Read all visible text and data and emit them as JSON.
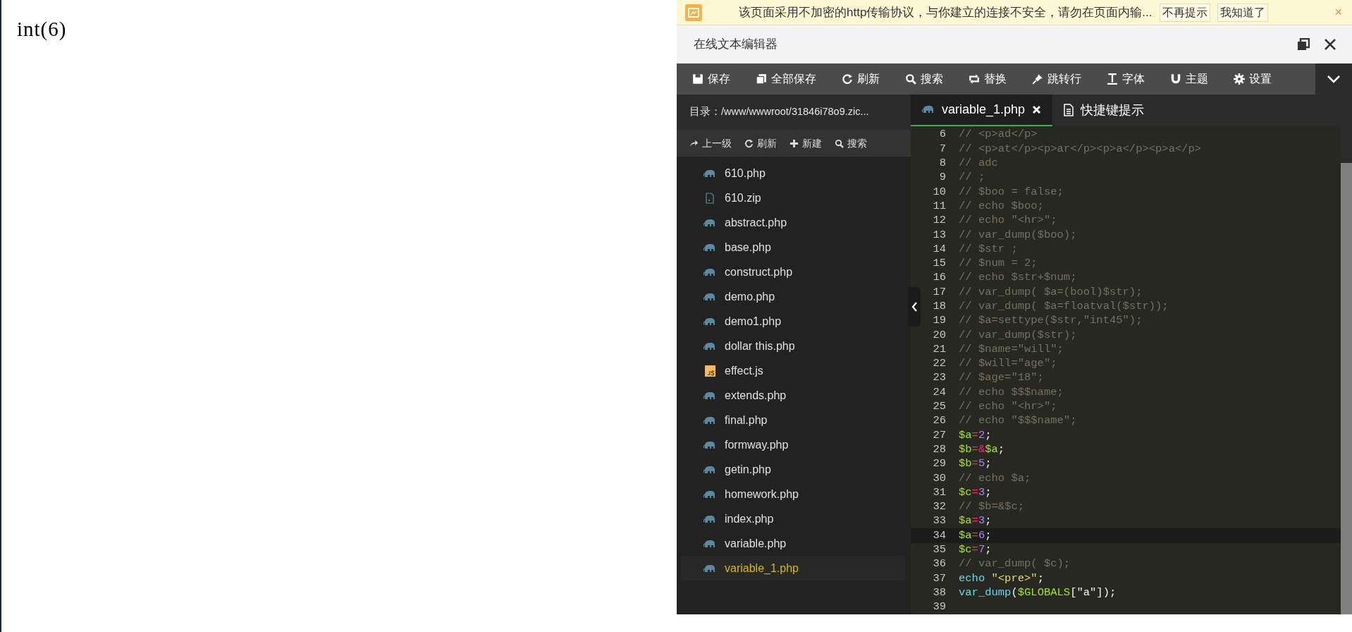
{
  "output": {
    "text": "int(6)"
  },
  "notice": {
    "text": "该页面采用不加密的http传输协议，与你建立的连接不安全，请勿在页面内输...",
    "buttons": [
      "不再提示",
      "我知道了"
    ],
    "close": "×"
  },
  "editor": {
    "title": "在线文本编辑器",
    "toolbar": [
      {
        "kind": "save",
        "label": "保存"
      },
      {
        "kind": "saveall",
        "label": "全部保存"
      },
      {
        "kind": "refresh",
        "label": "刷新"
      },
      {
        "kind": "search",
        "label": "搜索"
      },
      {
        "kind": "replace",
        "label": "替换"
      },
      {
        "kind": "goto",
        "label": "跳转行"
      },
      {
        "kind": "font",
        "label": "字体"
      },
      {
        "kind": "theme",
        "label": "主题"
      },
      {
        "kind": "settings",
        "label": "设置"
      }
    ],
    "directory": "目录：/www/wwwroot/31846i78o9.zic...",
    "tabs": [
      {
        "kind": "file",
        "label": "variable_1.php",
        "selected": true
      },
      {
        "kind": "doc",
        "label": "快捷键提示",
        "selected": false
      }
    ],
    "file_toolbar": [
      {
        "kind": "up",
        "label": "上一级"
      },
      {
        "kind": "refresh",
        "label": "刷新"
      },
      {
        "kind": "new",
        "label": "新建"
      },
      {
        "kind": "search",
        "label": "搜索"
      }
    ],
    "files": [
      {
        "kind": "php",
        "name": "610.php",
        "selected": false
      },
      {
        "kind": "zip",
        "name": "610.zip",
        "selected": false
      },
      {
        "kind": "php",
        "name": "abstract.php",
        "selected": false
      },
      {
        "kind": "php",
        "name": "base.php",
        "selected": false
      },
      {
        "kind": "php",
        "name": "construct.php",
        "selected": false
      },
      {
        "kind": "php",
        "name": "demo.php",
        "selected": false
      },
      {
        "kind": "php",
        "name": "demo1.php",
        "selected": false
      },
      {
        "kind": "php",
        "name": "dollar this.php",
        "selected": false
      },
      {
        "kind": "js",
        "name": "effect.js",
        "selected": false
      },
      {
        "kind": "php",
        "name": "extends.php",
        "selected": false
      },
      {
        "kind": "php",
        "name": "final.php",
        "selected": false
      },
      {
        "kind": "php",
        "name": "formway.php",
        "selected": false
      },
      {
        "kind": "php",
        "name": "getin.php",
        "selected": false
      },
      {
        "kind": "php",
        "name": "homework.php",
        "selected": false
      },
      {
        "kind": "php",
        "name": "index.php",
        "selected": false
      },
      {
        "kind": "php",
        "name": "variable.php",
        "selected": false
      },
      {
        "kind": "php",
        "name": "variable_1.php",
        "selected": true
      }
    ],
    "code": [
      {
        "number": "6",
        "active": false,
        "tokens": [
          {
            "kind": "comment",
            "text": "// <p>ad</p>"
          }
        ]
      },
      {
        "number": "7",
        "active": false,
        "tokens": [
          {
            "kind": "comment",
            "text": "// <p>at</p><p>ar</p><p>a</p><p>a</p>"
          }
        ]
      },
      {
        "number": "8",
        "active": false,
        "tokens": [
          {
            "kind": "comment",
            "text": "// adc"
          }
        ]
      },
      {
        "number": "9",
        "active": false,
        "tokens": [
          {
            "kind": "comment",
            "text": "// ;"
          }
        ]
      },
      {
        "number": "10",
        "active": false,
        "tokens": [
          {
            "kind": "comment",
            "text": "// $boo = false;"
          }
        ]
      },
      {
        "number": "11",
        "active": false,
        "tokens": [
          {
            "kind": "comment",
            "text": "// echo $boo;"
          }
        ]
      },
      {
        "number": "12",
        "active": false,
        "tokens": [
          {
            "kind": "comment",
            "text": "// echo \"<hr>\";"
          }
        ]
      },
      {
        "number": "13",
        "active": false,
        "tokens": [
          {
            "kind": "comment",
            "text": "// var_dump($boo);"
          }
        ]
      },
      {
        "number": "14",
        "active": false,
        "tokens": [
          {
            "kind": "comment",
            "text": "// $str ;"
          }
        ]
      },
      {
        "number": "15",
        "active": false,
        "tokens": [
          {
            "kind": "comment",
            "text": "// $num = 2;"
          }
        ]
      },
      {
        "number": "16",
        "active": false,
        "tokens": [
          {
            "kind": "comment",
            "text": "// echo $str+$num;"
          }
        ]
      },
      {
        "number": "17",
        "active": false,
        "tokens": [
          {
            "kind": "comment",
            "text": "// var_dump( $a=(bool)$str);"
          }
        ]
      },
      {
        "number": "18",
        "active": false,
        "tokens": [
          {
            "kind": "comment",
            "text": "// var_dump( $a=floatval($str));"
          }
        ]
      },
      {
        "number": "19",
        "active": false,
        "tokens": [
          {
            "kind": "comment",
            "text": "// $a=settype($str,\"int45\");"
          }
        ]
      },
      {
        "number": "20",
        "active": false,
        "tokens": [
          {
            "kind": "comment",
            "text": "// var_dump($str);"
          }
        ]
      },
      {
        "number": "21",
        "active": false,
        "tokens": [
          {
            "kind": "comment",
            "text": "// $name=\"will\";"
          }
        ]
      },
      {
        "number": "22",
        "active": false,
        "tokens": [
          {
            "kind": "comment",
            "text": "// $will=\"age\";"
          }
        ]
      },
      {
        "number": "23",
        "active": false,
        "tokens": [
          {
            "kind": "comment",
            "text": "// $age=\"18\";"
          }
        ]
      },
      {
        "number": "24",
        "active": false,
        "tokens": [
          {
            "kind": "comment",
            "text": "// echo $$$name;"
          }
        ]
      },
      {
        "number": "25",
        "active": false,
        "tokens": [
          {
            "kind": "comment",
            "text": "// echo \"<hr>\";"
          }
        ]
      },
      {
        "number": "26",
        "active": false,
        "tokens": [
          {
            "kind": "comment",
            "text": "// echo \"$$$name\";"
          }
        ]
      },
      {
        "number": "27",
        "active": false,
        "tokens": [
          {
            "kind": "var",
            "text": "$a"
          },
          {
            "kind": "op",
            "text": "="
          },
          {
            "kind": "num",
            "text": "2"
          },
          {
            "kind": "plain",
            "text": ";"
          }
        ]
      },
      {
        "number": "28",
        "active": false,
        "tokens": [
          {
            "kind": "var",
            "text": "$b"
          },
          {
            "kind": "op",
            "text": "=&"
          },
          {
            "kind": "var",
            "text": "$a"
          },
          {
            "kind": "plain",
            "text": ";"
          }
        ]
      },
      {
        "number": "29",
        "active": false,
        "tokens": [
          {
            "kind": "var",
            "text": "$b"
          },
          {
            "kind": "op",
            "text": "="
          },
          {
            "kind": "num",
            "text": "5"
          },
          {
            "kind": "plain",
            "text": ";"
          }
        ]
      },
      {
        "number": "30",
        "active": false,
        "tokens": [
          {
            "kind": "comment",
            "text": "// echo $a;"
          }
        ]
      },
      {
        "number": "31",
        "active": false,
        "tokens": [
          {
            "kind": "var",
            "text": "$c"
          },
          {
            "kind": "op",
            "text": "="
          },
          {
            "kind": "num",
            "text": "3"
          },
          {
            "kind": "plain",
            "text": ";"
          }
        ]
      },
      {
        "number": "32",
        "active": false,
        "tokens": [
          {
            "kind": "comment",
            "text": "// $b=&$c;"
          }
        ]
      },
      {
        "number": "33",
        "active": false,
        "tokens": [
          {
            "kind": "var",
            "text": "$a"
          },
          {
            "kind": "op",
            "text": "="
          },
          {
            "kind": "num",
            "text": "3"
          },
          {
            "kind": "plain",
            "text": ";"
          }
        ]
      },
      {
        "number": "34",
        "active": true,
        "tokens": [
          {
            "kind": "var",
            "text": "$a"
          },
          {
            "kind": "op",
            "text": "="
          },
          {
            "kind": "num",
            "text": "6"
          },
          {
            "kind": "plain",
            "text": ";"
          }
        ]
      },
      {
        "number": "35",
        "active": false,
        "tokens": [
          {
            "kind": "var",
            "text": "$c"
          },
          {
            "kind": "op",
            "text": "="
          },
          {
            "kind": "num",
            "text": "7"
          },
          {
            "kind": "plain",
            "text": ";"
          }
        ]
      },
      {
        "number": "36",
        "active": false,
        "tokens": [
          {
            "kind": "comment",
            "text": "// var_dump( $c);"
          }
        ]
      },
      {
        "number": "37",
        "active": false,
        "tokens": [
          {
            "kind": "func",
            "text": "echo "
          },
          {
            "kind": "str",
            "text": "\"<pre>\""
          },
          {
            "kind": "plain",
            "text": ";"
          }
        ]
      },
      {
        "number": "38",
        "active": false,
        "tokens": [
          {
            "kind": "func",
            "text": "var_dump"
          },
          {
            "kind": "plain",
            "text": "("
          },
          {
            "kind": "var",
            "text": "$GLOBALS"
          },
          {
            "kind": "plain",
            "text": "[\"a\"]);"
          }
        ]
      },
      {
        "number": "39",
        "active": false
      }
    ]
  }
}
